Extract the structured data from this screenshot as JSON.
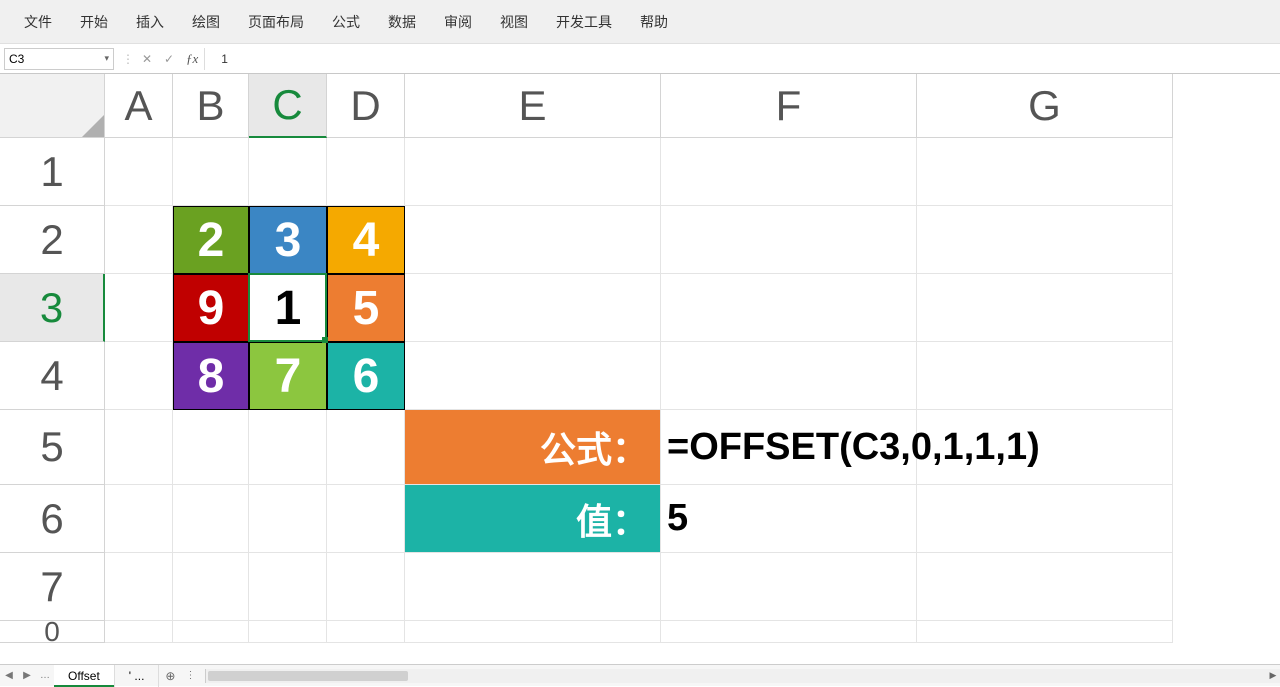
{
  "ribbon": [
    "文件",
    "开始",
    "插入",
    "绘图",
    "页面布局",
    "公式",
    "数据",
    "审阅",
    "视图",
    "开发工具",
    "帮助"
  ],
  "namebox": "C3",
  "formula_input": "1",
  "columns": [
    "A",
    "B",
    "C",
    "D",
    "E",
    "F",
    "G"
  ],
  "selected_col": "C",
  "rows": [
    "1",
    "2",
    "3",
    "4",
    "5",
    "6",
    "7"
  ],
  "rows_partial": "0",
  "selected_row": "3",
  "block": {
    "r2": {
      "B": "2",
      "C": "3",
      "D": "4"
    },
    "r3": {
      "B": "9",
      "C": "1",
      "D": "5"
    },
    "r4": {
      "B": "8",
      "C": "7",
      "D": "6"
    }
  },
  "labels": {
    "formula": "公式：",
    "value": "值："
  },
  "values": {
    "formula": "=OFFSET(C3,0,1,1,1)",
    "value": "5"
  },
  "sheets": {
    "active": "Offset",
    "other": "' ...",
    "plus": "⊕"
  },
  "chart_data": {
    "type": "table",
    "title": "OFFSET demo grid",
    "columns": [
      "B",
      "C",
      "D"
    ],
    "rows": [
      "2",
      "3",
      "4"
    ],
    "cells": [
      [
        2,
        3,
        4
      ],
      [
        9,
        1,
        5
      ],
      [
        8,
        7,
        6
      ]
    ],
    "formula": "=OFFSET(C3,0,1,1,1)",
    "result": 5
  }
}
